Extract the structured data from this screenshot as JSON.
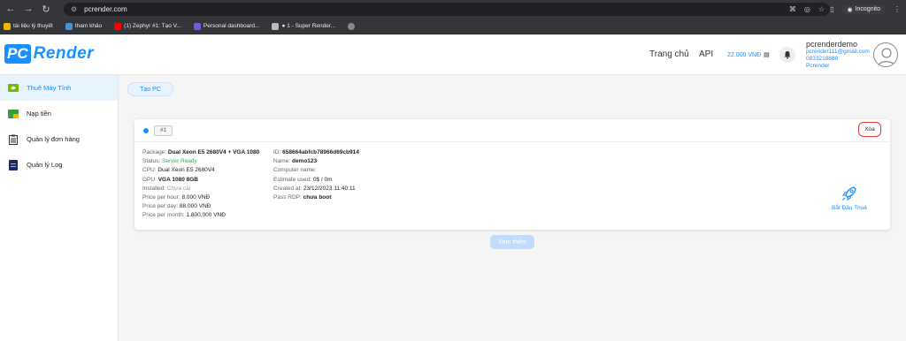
{
  "browser": {
    "url": "pcrender.com",
    "incognito_label": "Incognito",
    "bookmarks": [
      {
        "label": "tài liệu lý thuyết"
      },
      {
        "label": "tham khảo"
      },
      {
        "label": "(1) Zephyr #1: Tạo V..."
      },
      {
        "label": "Personal dashboard..."
      },
      {
        "label": "● 1 - Super Render..."
      }
    ]
  },
  "header": {
    "logo_pc": "PC",
    "logo_render": "Render",
    "nav_home": "Trang chủ",
    "nav_api": "API",
    "balance": "22.000 VNĐ",
    "user": {
      "name": "pcrenderdemo",
      "email": "pcrender111@gmail.com",
      "phone": "0833218888",
      "org": "Pcrender"
    }
  },
  "sidebar": {
    "items": [
      {
        "label": "Thuê Máy Tính",
        "icon": "nvidia-icon",
        "active": true
      },
      {
        "label": "Nạp tiền",
        "icon": "wallet-icon"
      },
      {
        "label": "Quản lý đơn hàng",
        "icon": "clipboard-icon"
      },
      {
        "label": "Quản lý Log",
        "icon": "log-file-icon"
      }
    ]
  },
  "main": {
    "create_label": "Tạo PC",
    "more_label": "Xem thêm",
    "card": {
      "tag": "#1",
      "delete_label": "Xóa",
      "start_label": "Bắt Đầu Thuê",
      "left": {
        "package_label": "Package:",
        "package_value": "Dual Xeon E5 2680V4 + VGA 1080",
        "status_label": "Status:",
        "status_value": "Server Ready",
        "cpu_label": "CPU:",
        "cpu_value": "Dual Xeon E5 2680V4",
        "gpu_label": "GPU:",
        "gpu_value": "VGA 1080 8GB",
        "installed_label": "Installed:",
        "installed_value": "Chưa cài",
        "hour_label": "Price per hour:",
        "hour_value": "8.000 VNĐ",
        "day_label": "Price per day:",
        "day_value": "88.000 VNĐ",
        "month_label": "Price per month:",
        "month_value": "1.800.000 VNĐ"
      },
      "right": {
        "id_label": "ID:",
        "id_value": "658664abfcb78966d69cb914",
        "name_label": "Name:",
        "name_value": "demo123",
        "computer_label": "Computer name:",
        "computer_value": "",
        "estimate_label": "Estimate used:",
        "estimate_value": "0$ / 0m",
        "created_label": "Created at:",
        "created_value": "23/12/2023 11:40:11",
        "pass_label": "Pass RDP:",
        "pass_value": "chưa boot"
      }
    }
  },
  "colors": {
    "primary": "#1890ff",
    "success": "#34a853",
    "danger": "#e53935"
  }
}
